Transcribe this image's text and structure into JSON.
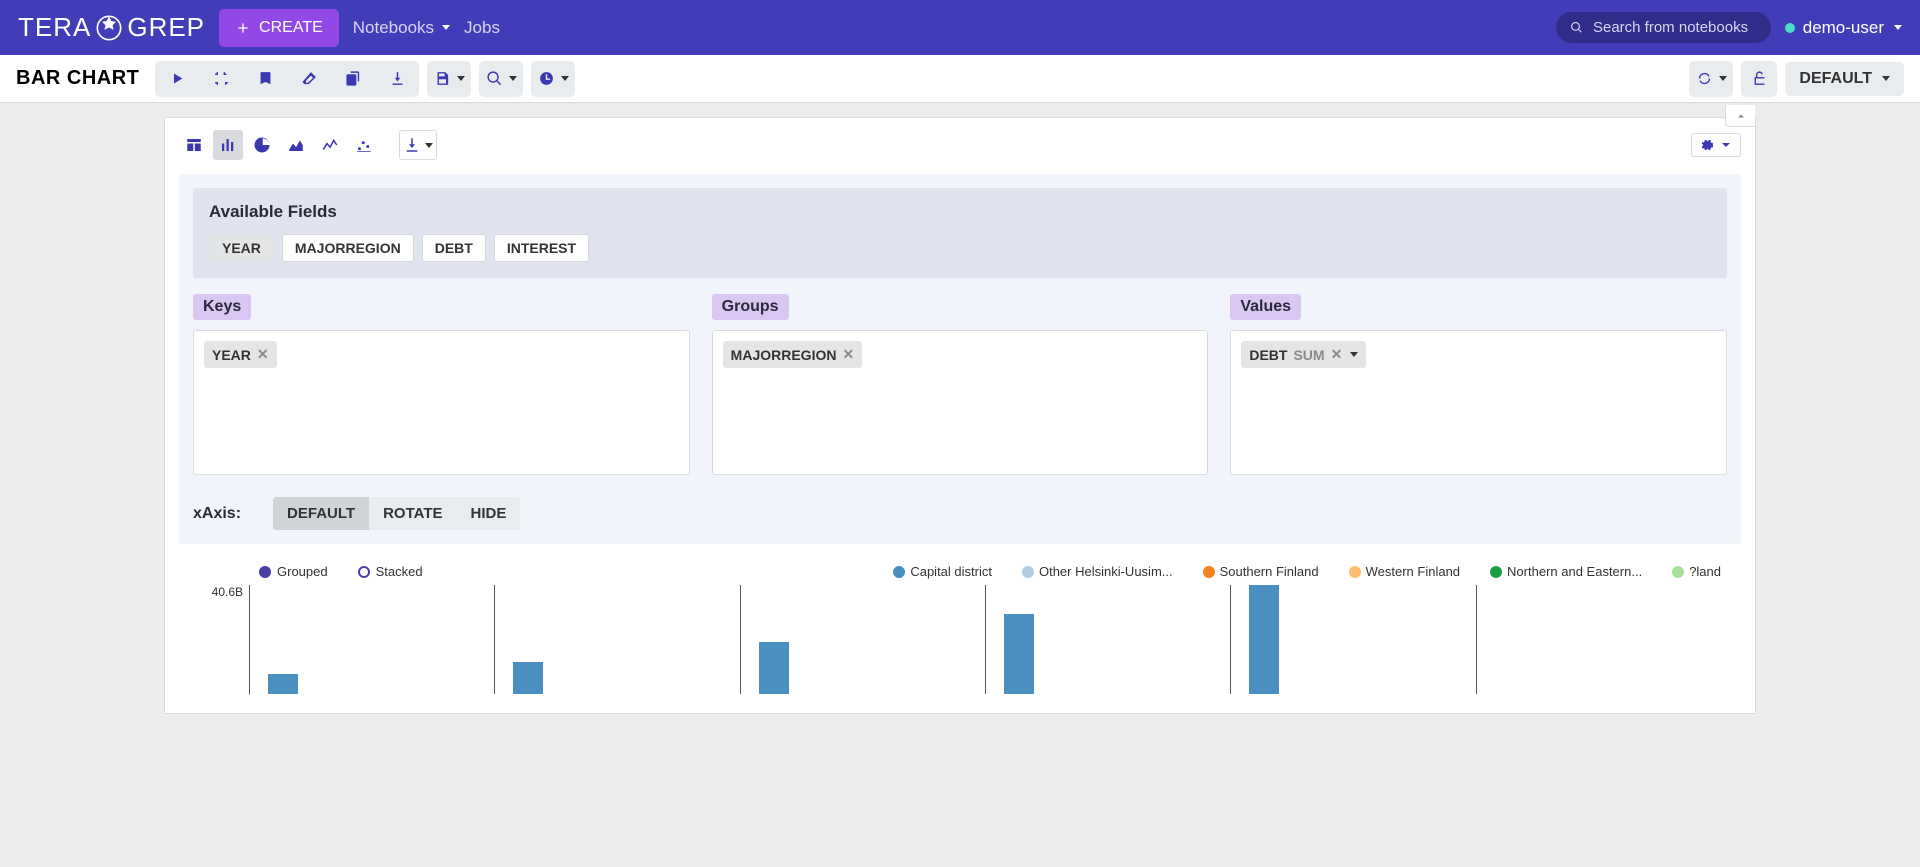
{
  "nav": {
    "brand_left": "TERA",
    "brand_right": "GREP",
    "create_label": "CREATE",
    "notebooks_label": "Notebooks",
    "jobs_label": "Jobs",
    "search_placeholder": "Search from notebooks",
    "user": "demo-user"
  },
  "toolbar": {
    "title": "BAR CHART",
    "default_label": "DEFAULT"
  },
  "config": {
    "available_title": "Available Fields",
    "available_fields": [
      "YEAR",
      "MAJORREGION",
      "DEBT",
      "INTEREST"
    ],
    "selected_available": "YEAR",
    "keys_label": "Keys",
    "groups_label": "Groups",
    "values_label": "Values",
    "keys": [
      {
        "name": "YEAR"
      }
    ],
    "groups": [
      {
        "name": "MAJORREGION"
      }
    ],
    "values": [
      {
        "name": "DEBT",
        "agg": "SUM"
      }
    ],
    "xaxis_label": "xAxis:",
    "xaxis_options": [
      "DEFAULT",
      "ROTATE",
      "HIDE"
    ],
    "xaxis_selected": "DEFAULT"
  },
  "chart_data": {
    "type": "bar",
    "mode_options": [
      "Grouped",
      "Stacked"
    ],
    "mode_selected": "Grouped",
    "ylabel_top": "40.6B",
    "ylim": [
      0,
      40.6
    ],
    "series": [
      {
        "name": "Capital district",
        "color": "#4a8fc2"
      },
      {
        "name": "Other Helsinki-Uusim...",
        "color": "#b3cde3"
      },
      {
        "name": "Southern Finland",
        "color": "#f58220"
      },
      {
        "name": "Western Finland",
        "color": "#fdbf6f"
      },
      {
        "name": "Northern and Eastern...",
        "color": "#1b9e3f"
      },
      {
        "name": "?land",
        "color": "#a6e29a"
      }
    ],
    "visible_bars": [
      {
        "group": 0,
        "height_frac": 0.18
      },
      {
        "group": 1,
        "height_frac": 0.29
      },
      {
        "group": 2,
        "height_frac": 0.48
      },
      {
        "group": 3,
        "height_frac": 0.73
      },
      {
        "group": 4,
        "height_frac": 1.0
      }
    ]
  }
}
